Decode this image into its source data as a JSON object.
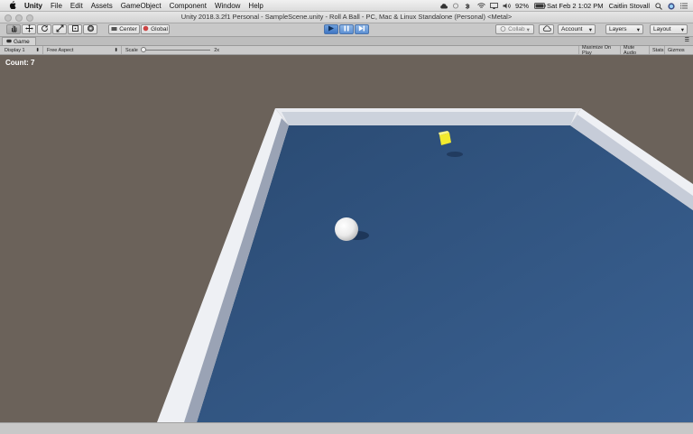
{
  "menubar": {
    "app": "Unity",
    "items": [
      "File",
      "Edit",
      "Assets",
      "GameObject",
      "Component",
      "Window",
      "Help"
    ],
    "battery": "92%",
    "datetime": "Sat Feb 2  1:02 PM",
    "user": "Caitlin Stovall"
  },
  "window": {
    "title": "Unity 2018.3.2f1 Personal - SampleScene.unity - Roll A Ball - PC, Mac & Linux Standalone (Personal) <Metal>"
  },
  "toolbar": {
    "pivot": "Center",
    "space": "Global",
    "collab": "Collab",
    "account": "Account",
    "layers": "Layers",
    "layout": "Layout"
  },
  "game_tab": {
    "label": "Game",
    "display": "Display 1",
    "aspect": "Free Aspect",
    "scale_label": "Scale",
    "scale_value": "2x",
    "maximize": "Maximize On Play",
    "mute": "Mute Audio",
    "stats": "Stats",
    "gizmos": "Gizmos"
  },
  "game": {
    "count_text": "Count: 7"
  },
  "colors": {
    "ground": "#6b625a",
    "floor": "#2e537e",
    "wall": "#e8eaef",
    "pickup": "#f2ea2e",
    "ball": "#f4f4f4",
    "play_active": "#4a7fcf"
  }
}
